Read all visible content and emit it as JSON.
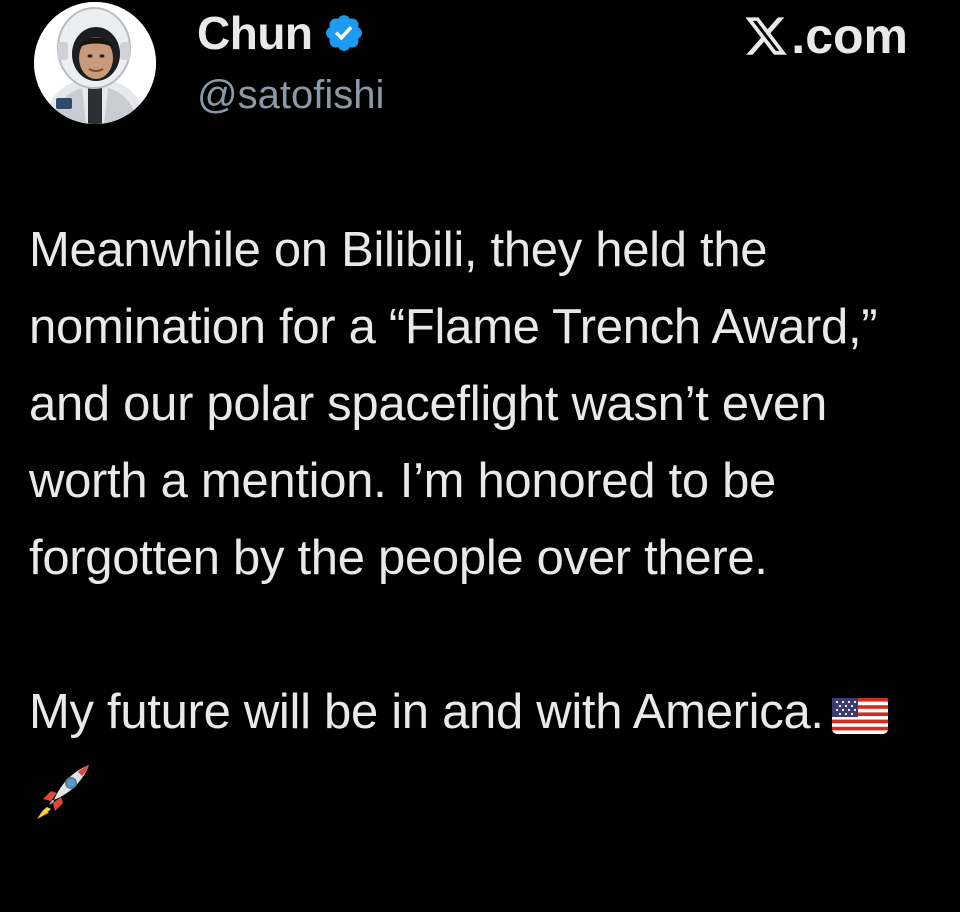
{
  "header": {
    "display_name": "Chun",
    "handle": "@satofishi",
    "brand": ".com",
    "verified": true,
    "verified_color": "#1d9bf0",
    "avatar_icon": "astronaut-avatar"
  },
  "tweet": {
    "paragraph_1": "Meanwhile on Bilibili, they held the nomination for a “Flame Trench Award,” and our polar spaceflight wasn’t even worth a mention. I’m honored to be forgotten by the people over there.",
    "paragraph_2": "My future will be in and with America.",
    "emojis": [
      "us-flag-emoji",
      "rocket-emoji"
    ]
  },
  "colors": {
    "background": "#000000",
    "text": "#e7e9ea",
    "muted": "#8b98a5"
  }
}
